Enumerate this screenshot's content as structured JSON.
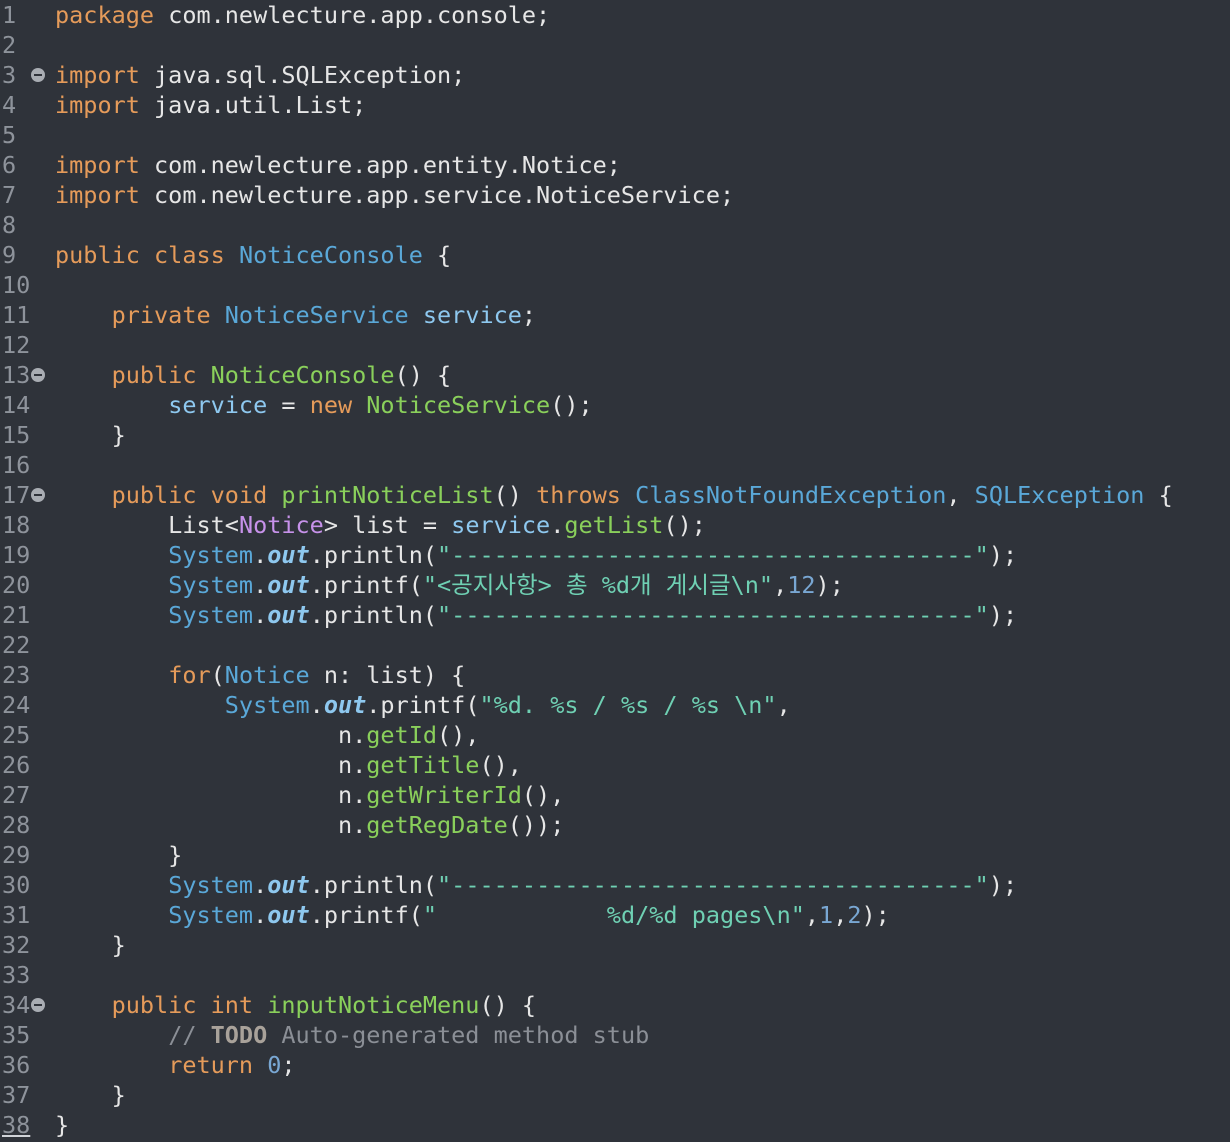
{
  "editor": {
    "lines": [
      {
        "n": "1",
        "fold": false,
        "tokens": [
          {
            "t": "package",
            "c": "keyword"
          },
          {
            "t": " com.newlecture.app.console;",
            "c": "plain"
          }
        ]
      },
      {
        "n": "2",
        "fold": false,
        "tokens": []
      },
      {
        "n": "3",
        "fold": true,
        "tokens": [
          {
            "t": "import",
            "c": "keyword"
          },
          {
            "t": " java.sql.SQLException;",
            "c": "plain"
          }
        ]
      },
      {
        "n": "4",
        "fold": false,
        "tokens": [
          {
            "t": "import",
            "c": "keyword"
          },
          {
            "t": " java.util.List;",
            "c": "plain"
          }
        ]
      },
      {
        "n": "5",
        "fold": false,
        "tokens": []
      },
      {
        "n": "6",
        "fold": false,
        "tokens": [
          {
            "t": "import",
            "c": "keyword"
          },
          {
            "t": " com.newlecture.app.entity.Notice;",
            "c": "plain"
          }
        ]
      },
      {
        "n": "7",
        "fold": false,
        "tokens": [
          {
            "t": "import",
            "c": "keyword"
          },
          {
            "t": " com.newlecture.app.service.NoticeService;",
            "c": "plain"
          }
        ]
      },
      {
        "n": "8",
        "fold": false,
        "tokens": []
      },
      {
        "n": "9",
        "fold": false,
        "tokens": [
          {
            "t": "public class ",
            "c": "keyword"
          },
          {
            "t": "NoticeConsole",
            "c": "type"
          },
          {
            "t": " {",
            "c": "plain"
          }
        ]
      },
      {
        "n": "10",
        "fold": false,
        "tokens": []
      },
      {
        "n": "11",
        "fold": false,
        "tokens": [
          {
            "t": "    ",
            "c": "plain"
          },
          {
            "t": "private ",
            "c": "keyword"
          },
          {
            "t": "NoticeService",
            "c": "type"
          },
          {
            "t": " ",
            "c": "plain"
          },
          {
            "t": "service",
            "c": "field"
          },
          {
            "t": ";",
            "c": "plain"
          }
        ]
      },
      {
        "n": "12",
        "fold": false,
        "tokens": []
      },
      {
        "n": "13",
        "fold": true,
        "tokens": [
          {
            "t": "    ",
            "c": "plain"
          },
          {
            "t": "public ",
            "c": "keyword"
          },
          {
            "t": "NoticeConsole",
            "c": "func"
          },
          {
            "t": "() {",
            "c": "plain"
          }
        ]
      },
      {
        "n": "14",
        "fold": false,
        "tokens": [
          {
            "t": "        ",
            "c": "plain"
          },
          {
            "t": "service",
            "c": "field"
          },
          {
            "t": " = ",
            "c": "plain"
          },
          {
            "t": "new ",
            "c": "keyword"
          },
          {
            "t": "NoticeService",
            "c": "func"
          },
          {
            "t": "();",
            "c": "plain"
          }
        ]
      },
      {
        "n": "15",
        "fold": false,
        "tokens": [
          {
            "t": "    }",
            "c": "plain"
          }
        ]
      },
      {
        "n": "16",
        "fold": false,
        "tokens": []
      },
      {
        "n": "17",
        "fold": true,
        "tokens": [
          {
            "t": "    ",
            "c": "plain"
          },
          {
            "t": "public void ",
            "c": "keyword"
          },
          {
            "t": "printNoticeList",
            "c": "func"
          },
          {
            "t": "() ",
            "c": "plain"
          },
          {
            "t": "throws ",
            "c": "keyword"
          },
          {
            "t": "ClassNotFoundException",
            "c": "type"
          },
          {
            "t": ", ",
            "c": "plain"
          },
          {
            "t": "SQLException",
            "c": "type"
          },
          {
            "t": " {",
            "c": "plain"
          }
        ]
      },
      {
        "n": "18",
        "fold": false,
        "tokens": [
          {
            "t": "        List<",
            "c": "plain"
          },
          {
            "t": "Notice",
            "c": "typeparam"
          },
          {
            "t": "> list = ",
            "c": "plain"
          },
          {
            "t": "service",
            "c": "field"
          },
          {
            "t": ".",
            "c": "plain"
          },
          {
            "t": "getList",
            "c": "func"
          },
          {
            "t": "();",
            "c": "plain"
          }
        ]
      },
      {
        "n": "19",
        "fold": false,
        "tokens": [
          {
            "t": "        ",
            "c": "plain"
          },
          {
            "t": "System",
            "c": "type"
          },
          {
            "t": ".",
            "c": "plain"
          },
          {
            "t": "out",
            "c": "static"
          },
          {
            "t": ".println(",
            "c": "plain"
          },
          {
            "t": "\"-------------------------------------\"",
            "c": "string"
          },
          {
            "t": ");",
            "c": "plain"
          }
        ]
      },
      {
        "n": "20",
        "fold": false,
        "tokens": [
          {
            "t": "        ",
            "c": "plain"
          },
          {
            "t": "System",
            "c": "type"
          },
          {
            "t": ".",
            "c": "plain"
          },
          {
            "t": "out",
            "c": "static"
          },
          {
            "t": ".printf(",
            "c": "plain"
          },
          {
            "t": "\"<공지사항> 총 %d개 게시글\\n\"",
            "c": "string"
          },
          {
            "t": ",",
            "c": "plain"
          },
          {
            "t": "12",
            "c": "num"
          },
          {
            "t": ");",
            "c": "plain"
          }
        ]
      },
      {
        "n": "21",
        "fold": false,
        "tokens": [
          {
            "t": "        ",
            "c": "plain"
          },
          {
            "t": "System",
            "c": "type"
          },
          {
            "t": ".",
            "c": "plain"
          },
          {
            "t": "out",
            "c": "static"
          },
          {
            "t": ".println(",
            "c": "plain"
          },
          {
            "t": "\"-------------------------------------\"",
            "c": "string"
          },
          {
            "t": ");",
            "c": "plain"
          }
        ]
      },
      {
        "n": "22",
        "fold": false,
        "tokens": []
      },
      {
        "n": "23",
        "fold": false,
        "tokens": [
          {
            "t": "        ",
            "c": "plain"
          },
          {
            "t": "for",
            "c": "keyword"
          },
          {
            "t": "(",
            "c": "plain"
          },
          {
            "t": "Notice",
            "c": "type"
          },
          {
            "t": " n: list) {",
            "c": "plain"
          }
        ]
      },
      {
        "n": "24",
        "fold": false,
        "tokens": [
          {
            "t": "            ",
            "c": "plain"
          },
          {
            "t": "System",
            "c": "type"
          },
          {
            "t": ".",
            "c": "plain"
          },
          {
            "t": "out",
            "c": "static"
          },
          {
            "t": ".printf(",
            "c": "plain"
          },
          {
            "t": "\"%d. %s / %s / %s \\n\"",
            "c": "string"
          },
          {
            "t": ",",
            "c": "plain"
          }
        ]
      },
      {
        "n": "25",
        "fold": false,
        "tokens": [
          {
            "t": "                    n.",
            "c": "plain"
          },
          {
            "t": "getId",
            "c": "func"
          },
          {
            "t": "(),",
            "c": "plain"
          }
        ]
      },
      {
        "n": "26",
        "fold": false,
        "tokens": [
          {
            "t": "                    n.",
            "c": "plain"
          },
          {
            "t": "getTitle",
            "c": "func"
          },
          {
            "t": "(),",
            "c": "plain"
          }
        ]
      },
      {
        "n": "27",
        "fold": false,
        "tokens": [
          {
            "t": "                    n.",
            "c": "plain"
          },
          {
            "t": "getWriterId",
            "c": "func"
          },
          {
            "t": "(),",
            "c": "plain"
          }
        ]
      },
      {
        "n": "28",
        "fold": false,
        "tokens": [
          {
            "t": "                    n.",
            "c": "plain"
          },
          {
            "t": "getRegDate",
            "c": "func"
          },
          {
            "t": "());",
            "c": "plain"
          }
        ]
      },
      {
        "n": "29",
        "fold": false,
        "tokens": [
          {
            "t": "        }",
            "c": "plain"
          }
        ]
      },
      {
        "n": "30",
        "fold": false,
        "tokens": [
          {
            "t": "        ",
            "c": "plain"
          },
          {
            "t": "System",
            "c": "type"
          },
          {
            "t": ".",
            "c": "plain"
          },
          {
            "t": "out",
            "c": "static"
          },
          {
            "t": ".println(",
            "c": "plain"
          },
          {
            "t": "\"-------------------------------------\"",
            "c": "string"
          },
          {
            "t": ");",
            "c": "plain"
          }
        ]
      },
      {
        "n": "31",
        "fold": false,
        "tokens": [
          {
            "t": "        ",
            "c": "plain"
          },
          {
            "t": "System",
            "c": "type"
          },
          {
            "t": ".",
            "c": "plain"
          },
          {
            "t": "out",
            "c": "static"
          },
          {
            "t": ".printf(",
            "c": "plain"
          },
          {
            "t": "\"            %d/%d pages\\n\"",
            "c": "string"
          },
          {
            "t": ",",
            "c": "plain"
          },
          {
            "t": "1",
            "c": "num"
          },
          {
            "t": ",",
            "c": "plain"
          },
          {
            "t": "2",
            "c": "num"
          },
          {
            "t": ");",
            "c": "plain"
          }
        ]
      },
      {
        "n": "32",
        "fold": false,
        "tokens": [
          {
            "t": "    }",
            "c": "plain"
          }
        ]
      },
      {
        "n": "33",
        "fold": false,
        "tokens": []
      },
      {
        "n": "34",
        "fold": true,
        "tokens": [
          {
            "t": "    ",
            "c": "plain"
          },
          {
            "t": "public int ",
            "c": "keyword"
          },
          {
            "t": "inputNoticeMenu",
            "c": "func"
          },
          {
            "t": "() {",
            "c": "plain"
          }
        ]
      },
      {
        "n": "35",
        "fold": false,
        "tokens": [
          {
            "t": "        ",
            "c": "plain"
          },
          {
            "t": "// ",
            "c": "comment"
          },
          {
            "t": "TODO",
            "c": "todo"
          },
          {
            "t": " Auto-generated method stub",
            "c": "comment"
          }
        ]
      },
      {
        "n": "36",
        "fold": false,
        "tokens": [
          {
            "t": "        ",
            "c": "plain"
          },
          {
            "t": "return ",
            "c": "keyword"
          },
          {
            "t": "0",
            "c": "num"
          },
          {
            "t": ";",
            "c": "plain"
          }
        ]
      },
      {
        "n": "37",
        "fold": false,
        "tokens": [
          {
            "t": "    }",
            "c": "plain"
          }
        ]
      },
      {
        "n": "38",
        "fold": false,
        "last": true,
        "tokens": [
          {
            "t": "}",
            "c": "plain"
          }
        ]
      }
    ]
  }
}
